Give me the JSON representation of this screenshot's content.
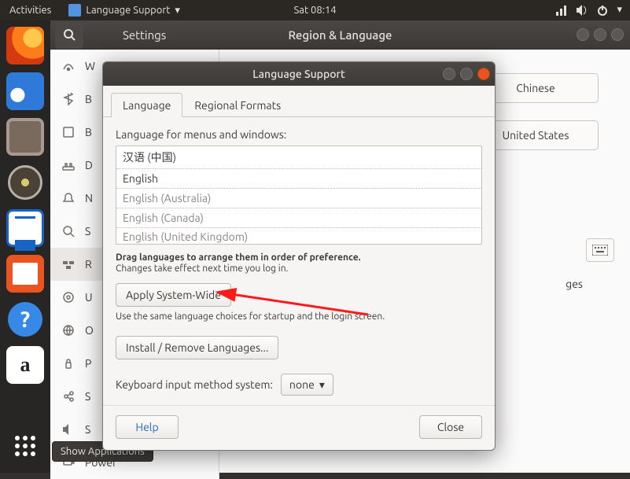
{
  "topbar": {
    "activities": "Activities",
    "app_name": "Language Support",
    "clock": "Sat 08:14"
  },
  "dock": {
    "show_apps_tooltip": "Show Applications"
  },
  "settings": {
    "title_left": "Settings",
    "title_center": "Region & Language",
    "sidebar": [
      {
        "label": "Wi-Fi"
      },
      {
        "label": "Bluetooth"
      },
      {
        "label": "Background"
      },
      {
        "label": "Dock"
      },
      {
        "label": "Notifications"
      },
      {
        "label": "Search"
      },
      {
        "label": "Region & Language"
      },
      {
        "label": "Universal Access"
      },
      {
        "label": "Online Accounts"
      },
      {
        "label": "Privacy"
      },
      {
        "label": "Sharing"
      },
      {
        "label": "Sound"
      },
      {
        "label": "Power"
      }
    ],
    "region_buttons": {
      "language_value": "Chinese",
      "formats_value": "United States",
      "trailing_text": "ges"
    }
  },
  "lang_dialog": {
    "title": "Language Support",
    "tabs": {
      "language": "Language",
      "regional": "Regional Formats"
    },
    "lbl_menus": "Language for menus and windows:",
    "languages": [
      {
        "text": "汉语 (中国)",
        "dim": false
      },
      {
        "text": "English",
        "dim": false
      },
      {
        "text": "English (Australia)",
        "dim": true
      },
      {
        "text": "English (Canada)",
        "dim": true
      },
      {
        "text": "English (United Kingdom)",
        "dim": true
      }
    ],
    "hint_drag_bold": "Drag languages to arrange them in order of preference.",
    "hint_drag_sub": "Changes take effect next time you log in.",
    "btn_apply": "Apply System-Wide",
    "hint_apply": "Use the same language choices for startup and the login screen.",
    "btn_install": "Install / Remove Languages...",
    "kb_label": "Keyboard input method system:",
    "kb_value": "none",
    "btn_help": "Help",
    "btn_close": "Close"
  }
}
